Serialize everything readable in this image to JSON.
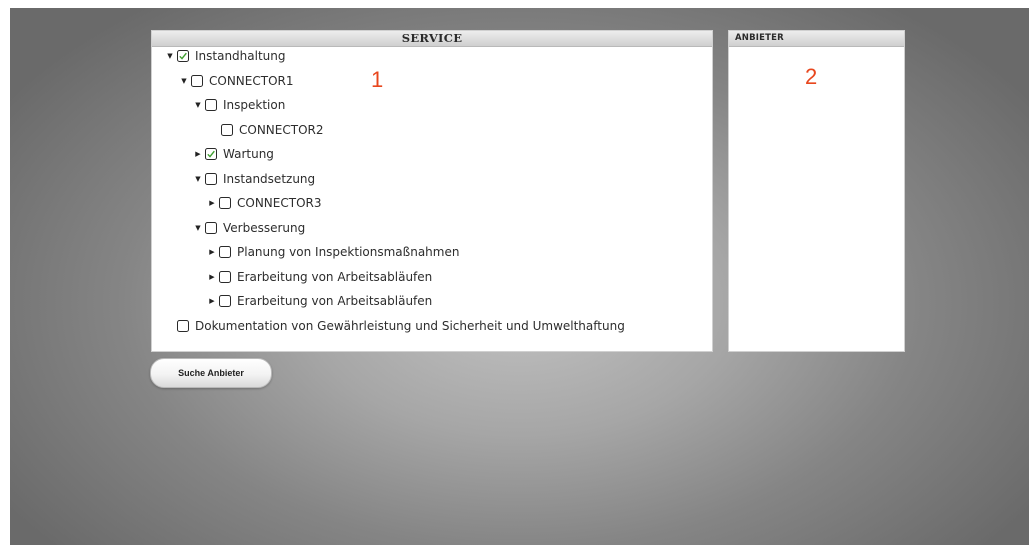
{
  "service_panel": {
    "title": "SERVICE",
    "marker": "1",
    "tree": [
      {
        "label": "Instandhaltung",
        "arrow": "expanded",
        "checked": true
      },
      {
        "label": "CONNECTOR1",
        "arrow": "expanded",
        "checked": false
      },
      {
        "label": "Inspektion",
        "arrow": "expanded",
        "checked": false
      },
      {
        "label": "CONNECTOR2",
        "arrow": "none",
        "checked": false
      },
      {
        "label": "Wartung",
        "arrow": "collapsed",
        "checked": true
      },
      {
        "label": "Instandsetzung",
        "arrow": "expanded",
        "checked": false
      },
      {
        "label": "CONNECTOR3",
        "arrow": "collapsed",
        "checked": false
      },
      {
        "label": "Verbesserung",
        "arrow": "expanded",
        "checked": false
      },
      {
        "label": "Planung von Inspektionsmaßnahmen",
        "arrow": "collapsed",
        "checked": false
      },
      {
        "label": "Erarbeitung von Arbeitsabläufen",
        "arrow": "collapsed",
        "checked": false
      },
      {
        "label": "Erarbeitung von Arbeitsabläufen",
        "arrow": "collapsed",
        "checked": false
      },
      {
        "label": "Dokumentation von Gewährleistung und Sicherheit und Umwelthaftung",
        "arrow": "none",
        "checked": false
      }
    ]
  },
  "provider_panel": {
    "title": "ANBIETER",
    "marker": "2"
  },
  "search_button": {
    "label": "Suche Anbieter"
  },
  "colors": {
    "checkmark": "#3f9f2f",
    "marker": "#e8461d"
  }
}
